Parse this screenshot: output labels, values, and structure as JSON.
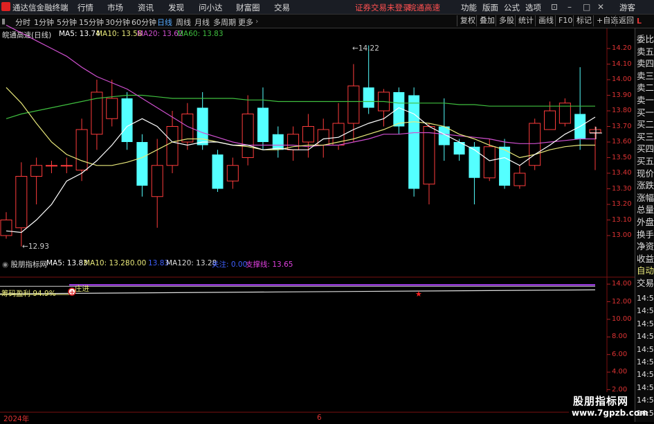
{
  "menubar": {
    "app_title": "通达信金融终端",
    "items": [
      "行情",
      "市场",
      "资讯",
      "发现",
      "问小达",
      "财富圈",
      "交易"
    ],
    "status": "证券交易未登录",
    "stock_name": "皖通高速",
    "right_items": [
      "功能",
      "版面",
      "公式",
      "选项"
    ],
    "user": "游客"
  },
  "periodbar": {
    "periods": [
      "分时",
      "1分钟",
      "5分钟",
      "15分钟",
      "30分钟",
      "60分钟",
      "日线",
      "周线",
      "月线",
      "多周期",
      "更多"
    ],
    "active": "日线",
    "right_buttons": [
      "复权",
      "叠加",
      "多股",
      "统计",
      "画线",
      "F10",
      "标记",
      "+自选",
      "返回"
    ]
  },
  "main_legend": {
    "title": "皖通高速(日线)",
    "ma5": "MA5: 13.74",
    "ma10": "MA10: 13.58",
    "ma20": "MA20: 13.62",
    "ma60": "MA60: 13.83",
    "colors": {
      "ma5": "#ffffff",
      "ma10": "#e8e87a",
      "ma20": "#d050d0",
      "ma60": "#3fbf3f"
    }
  },
  "price_axis": [
    "14.20",
    "14.10",
    "14.00",
    "13.90",
    "13.80",
    "13.70",
    "13.60",
    "13.50",
    "13.40",
    "13.30",
    "13.20",
    "13.10",
    "13.00"
  ],
  "annotations": {
    "high": "14.22",
    "low": "12.93"
  },
  "indicator_legend": {
    "title": "股朋指标网",
    "ma5": "MA5: 13.83",
    "ma10": "MA10: 13.28",
    "zero": ": 0.00",
    "v1": "13.83",
    "ma120": "MA120: 13.28",
    "label_a": "关注: 0.00",
    "support": "支撑线: 13.65"
  },
  "indicator_axis": [
    "14.00",
    "12.00",
    "10.00",
    "8.00",
    "6.00",
    "4.00",
    "2.00"
  ],
  "indicator_labels": {
    "chip_profit": "筹码盈利 94.9%",
    "banker": "庄进"
  },
  "right_column": [
    "委比",
    "卖五",
    "卖四",
    "卖三",
    "卖二",
    "卖一",
    "买一",
    "买二",
    "买三",
    "买四",
    "买五",
    "现价",
    "涨跌",
    "涨幅",
    "总量",
    "外盘",
    "换手",
    "净资",
    "收益",
    "自动",
    "交易",
    "14:56",
    "14:56",
    "14:56",
    "14:56",
    "14:56",
    "14:56",
    "14:56",
    "14:56",
    "14:56",
    "14:56"
  ],
  "right_top": "L",
  "date_axis": {
    "start": "2024年",
    "mid": "6"
  },
  "watermark": {
    "line1": "股朋指标网",
    "line2": "www.7gpzb.com"
  },
  "chart_data": {
    "type": "candlestick",
    "ylim": [
      12.9,
      14.3
    ],
    "candles": [
      {
        "o": 13.0,
        "c": 13.1,
        "h": 13.15,
        "l": 12.98
      },
      {
        "o": 13.05,
        "c": 13.38,
        "h": 13.47,
        "l": 12.93
      },
      {
        "o": 13.38,
        "c": 13.45,
        "h": 13.5,
        "l": 13.2
      },
      {
        "o": 13.45,
        "c": 13.45,
        "h": 13.48,
        "l": 13.4
      },
      {
        "o": 13.45,
        "c": 13.45,
        "h": 13.5,
        "l": 13.4
      },
      {
        "o": 13.42,
        "c": 13.68,
        "h": 13.75,
        "l": 13.35
      },
      {
        "o": 13.65,
        "c": 13.92,
        "h": 14.0,
        "l": 13.55
      },
      {
        "o": 13.75,
        "c": 13.88,
        "h": 14.0,
        "l": 13.7
      },
      {
        "o": 13.88,
        "c": 13.6,
        "h": 13.92,
        "l": 13.55
      },
      {
        "o": 13.6,
        "c": 13.32,
        "h": 13.65,
        "l": 13.25
      },
      {
        "o": 13.25,
        "c": 13.45,
        "h": 13.62,
        "l": 13.05
      },
      {
        "o": 13.45,
        "c": 13.7,
        "h": 13.8,
        "l": 13.4
      },
      {
        "o": 13.6,
        "c": 13.78,
        "h": 13.85,
        "l": 13.55
      },
      {
        "o": 13.82,
        "c": 13.58,
        "h": 13.92,
        "l": 13.55
      },
      {
        "o": 13.52,
        "c": 13.3,
        "h": 13.55,
        "l": 13.28
      },
      {
        "o": 13.35,
        "c": 13.45,
        "h": 13.5,
        "l": 13.3
      },
      {
        "o": 13.5,
        "c": 13.78,
        "h": 13.9,
        "l": 13.45
      },
      {
        "o": 13.82,
        "c": 13.6,
        "h": 13.95,
        "l": 13.55
      },
      {
        "o": 13.65,
        "c": 13.55,
        "h": 13.7,
        "l": 13.5
      },
      {
        "o": 13.55,
        "c": 13.65,
        "h": 13.7,
        "l": 13.48
      },
      {
        "o": 13.6,
        "c": 13.7,
        "h": 13.78,
        "l": 13.5
      },
      {
        "o": 13.58,
        "c": 13.68,
        "h": 13.75,
        "l": 13.5
      },
      {
        "o": 13.58,
        "c": 13.72,
        "h": 13.85,
        "l": 13.55
      },
      {
        "o": 13.72,
        "c": 13.96,
        "h": 14.1,
        "l": 13.6
      },
      {
        "o": 13.95,
        "c": 13.82,
        "h": 14.22,
        "l": 13.78
      },
      {
        "o": 13.8,
        "c": 13.92,
        "h": 13.94,
        "l": 13.7
      },
      {
        "o": 13.92,
        "c": 13.7,
        "h": 13.95,
        "l": 13.65
      },
      {
        "o": 13.9,
        "c": 13.3,
        "h": 13.95,
        "l": 13.25
      },
      {
        "o": 13.33,
        "c": 13.7,
        "h": 13.72,
        "l": 13.2
      },
      {
        "o": 13.7,
        "c": 13.58,
        "h": 13.88,
        "l": 13.48
      },
      {
        "o": 13.6,
        "c": 13.52,
        "h": 13.62,
        "l": 13.48
      },
      {
        "o": 13.57,
        "c": 13.37,
        "h": 13.6,
        "l": 13.2
      },
      {
        "o": 13.37,
        "c": 13.57,
        "h": 13.62,
        "l": 13.35
      },
      {
        "o": 13.57,
        "c": 13.32,
        "h": 13.62,
        "l": 13.3
      },
      {
        "o": 13.32,
        "c": 13.4,
        "h": 13.45,
        "l": 13.3
      },
      {
        "o": 13.45,
        "c": 13.72,
        "h": 13.75,
        "l": 13.42
      },
      {
        "o": 13.68,
        "c": 13.8,
        "h": 13.86,
        "l": 13.68
      },
      {
        "o": 13.72,
        "c": 13.85,
        "h": 13.88,
        "l": 13.7
      },
      {
        "o": 13.78,
        "c": 13.62,
        "h": 14.08,
        "l": 13.55
      },
      {
        "o": 13.66,
        "c": 13.68,
        "h": 13.7,
        "l": 13.42
      }
    ],
    "ma5": [
      13.03,
      13.02,
      13.1,
      13.2,
      13.35,
      13.4,
      13.48,
      13.58,
      13.7,
      13.75,
      13.7,
      13.6,
      13.58,
      13.6,
      13.6,
      13.58,
      13.58,
      13.55,
      13.56,
      13.55,
      13.55,
      13.62,
      13.63,
      13.68,
      13.72,
      13.75,
      13.82,
      13.78,
      13.7,
      13.65,
      13.6,
      13.55,
      13.48,
      13.5,
      13.45,
      13.52,
      13.58,
      13.65,
      13.7,
      13.76
    ],
    "ma10": [
      13.95,
      13.85,
      13.72,
      13.6,
      13.52,
      13.48,
      13.45,
      13.45,
      13.47,
      13.5,
      13.55,
      13.6,
      13.62,
      13.62,
      13.6,
      13.58,
      13.57,
      13.55,
      13.55,
      13.57,
      13.58,
      13.58,
      13.6,
      13.62,
      13.65,
      13.68,
      13.72,
      13.73,
      13.72,
      13.7,
      13.65,
      13.62,
      13.58,
      13.55,
      13.5,
      13.52,
      13.55,
      13.57,
      13.58,
      13.58
    ],
    "ma20": [
      14.35,
      14.3,
      14.25,
      14.2,
      14.15,
      14.08,
      14.02,
      13.98,
      13.94,
      13.88,
      13.82,
      13.76,
      13.7,
      13.66,
      13.63,
      13.6,
      13.58,
      13.58,
      13.58,
      13.58,
      13.57,
      13.58,
      13.58,
      13.6,
      13.62,
      13.65,
      13.65,
      13.66,
      13.66,
      13.65,
      13.64,
      13.63,
      13.62,
      13.6,
      13.59,
      13.59,
      13.6,
      13.61,
      13.62,
      13.62
    ],
    "ma60": [
      13.75,
      13.78,
      13.8,
      13.82,
      13.84,
      13.86,
      13.88,
      13.89,
      13.9,
      13.9,
      13.89,
      13.88,
      13.88,
      13.88,
      13.88,
      13.88,
      13.87,
      13.87,
      13.86,
      13.86,
      13.86,
      13.86,
      13.86,
      13.86,
      13.86,
      13.86,
      13.85,
      13.85,
      13.85,
      13.85,
      13.84,
      13.84,
      13.83,
      13.83,
      13.83,
      13.83,
      13.83,
      13.83,
      13.83,
      13.83
    ],
    "indicator": {
      "ylim": [
        0,
        15
      ],
      "purple": 13.83,
      "white_start": 12.9,
      "white_end": 13.35
    }
  }
}
